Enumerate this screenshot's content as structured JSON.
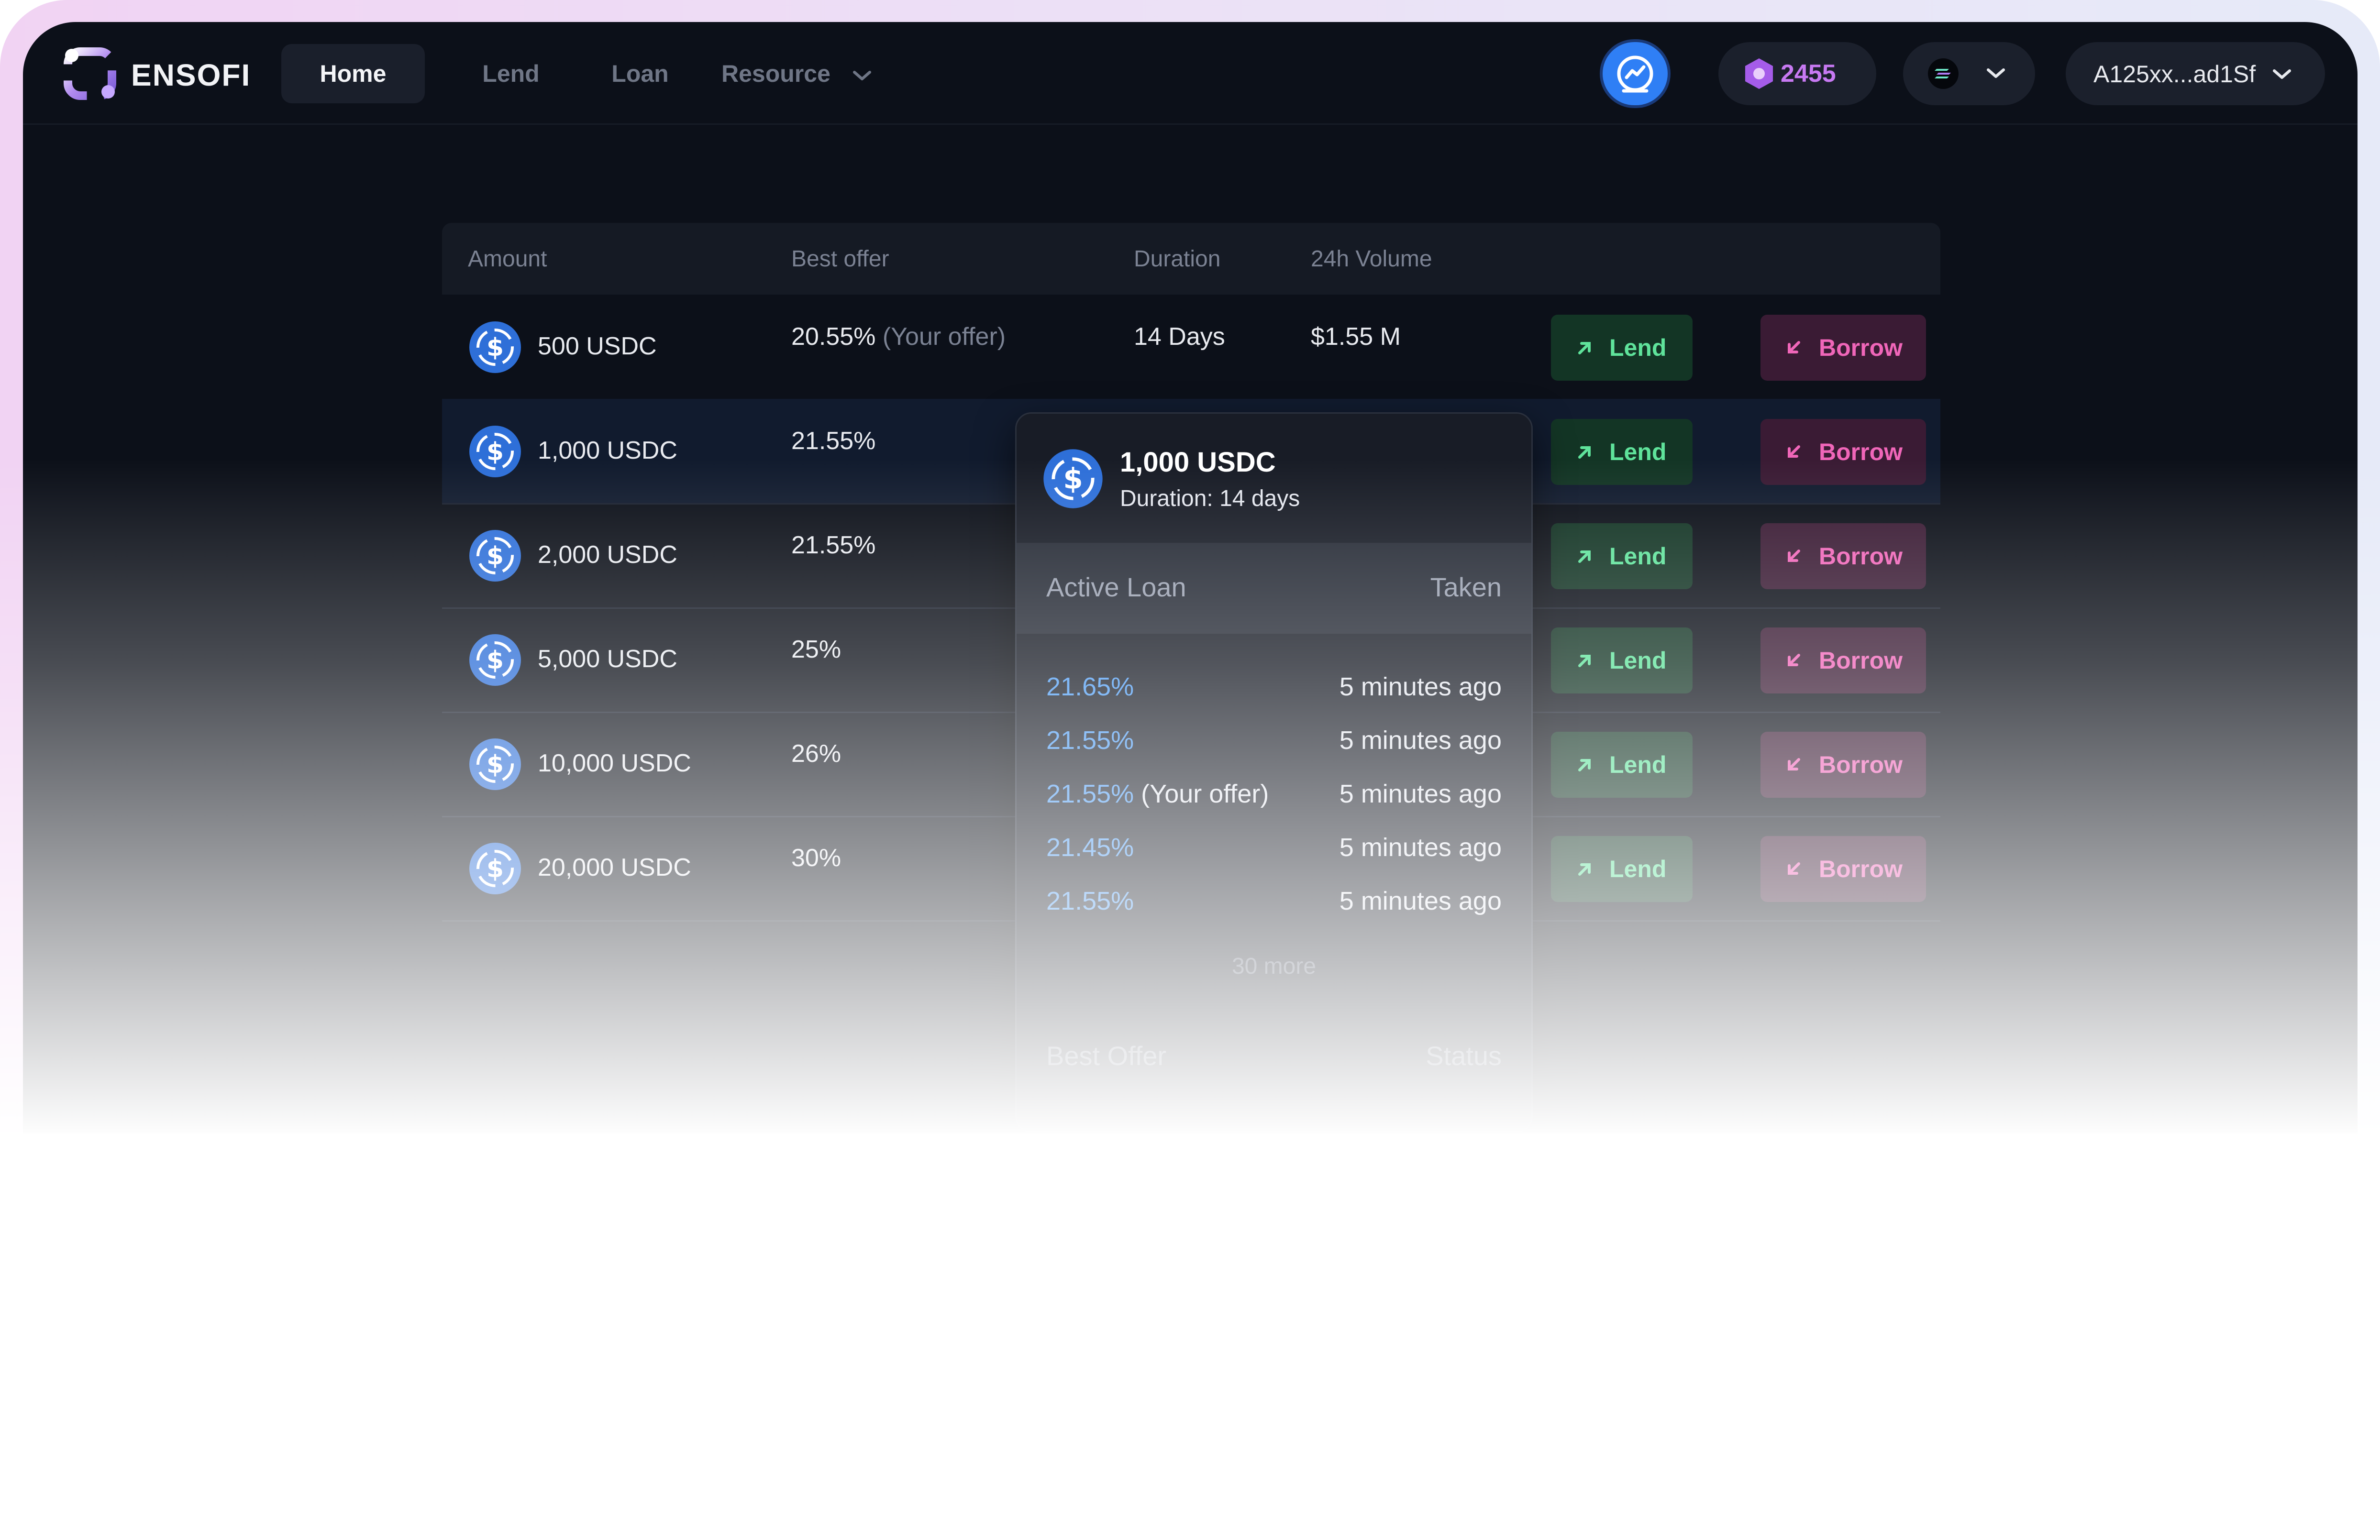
{
  "brand": {
    "name": "ENSOFI"
  },
  "nav": {
    "home": "Home",
    "lend": "Lend",
    "loan": "Loan",
    "resource": "Resource"
  },
  "header": {
    "points": "2455",
    "account": "A125xx...ad1Sf",
    "icons": [
      "chart-icon",
      "points-hex-icon",
      "solana-icon",
      "chevron-down-icon"
    ]
  },
  "table": {
    "headers": {
      "amount": "Amount",
      "best_offer": "Best offer",
      "duration": "Duration",
      "volume": "24h Volume"
    },
    "lend_label": "Lend",
    "borrow_label": "Borrow",
    "rows": [
      {
        "amount": "500 USDC",
        "offer": "20.55%",
        "offer_note": "(Your offer)",
        "duration": "14 Days",
        "volume": "$1.55 M"
      },
      {
        "amount": "1,000 USDC",
        "offer": "21.55%"
      },
      {
        "amount": "2,000 USDC",
        "offer": "21.55%"
      },
      {
        "amount": "5,000 USDC",
        "offer": "25%"
      },
      {
        "amount": "10,000 USDC",
        "offer": "26%"
      },
      {
        "amount": "20,000 USDC",
        "offer": "30%"
      }
    ]
  },
  "popup": {
    "title": "1,000 USDC",
    "duration": "Duration: 14 days",
    "col_left": "Active Loan",
    "col_right": "Taken",
    "loans": [
      {
        "rate": "21.65%",
        "note": "",
        "time": "5 minutes ago"
      },
      {
        "rate": "21.55%",
        "note": "",
        "time": "5 minutes ago"
      },
      {
        "rate": "21.55%",
        "note": "(Your offer)",
        "time": "5 minutes ago"
      },
      {
        "rate": "21.45%",
        "note": "",
        "time": "5 minutes ago"
      },
      {
        "rate": "21.55%",
        "note": "",
        "time": "5 minutes ago"
      }
    ],
    "more": "30 more",
    "foot_left": "Best Offer",
    "foot_right": "Status"
  },
  "colors": {
    "background": "#0c1019",
    "lend_text": "#5fe39b",
    "borrow_text": "#f066b9",
    "accent_blue": "#2f7ff5",
    "rate_blue": "#4f9cf2",
    "points_purple": "#c779f2"
  }
}
